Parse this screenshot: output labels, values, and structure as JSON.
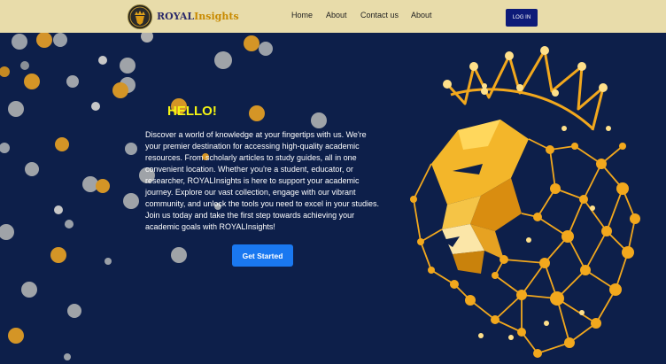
{
  "header": {
    "brand_part1": "ROYAL",
    "brand_part2": "Insights",
    "nav": [
      "Home",
      "About",
      "Contact us",
      "About"
    ],
    "login_label": "LOG IN"
  },
  "hero": {
    "greeting": "HELLO!",
    "description": "Discover a world of knowledge at your fingertips with us. We're your premier destination for accessing high-quality academic resources. From scholarly articles to study guides, all in one convenient location. Whether you're a student, educator, or researcher, ROYALInsights is here to support your academic journey. Explore our vast collection, engage with our vibrant community, and unlock the tools you need to excel in your studies. Join us today and take the first step towards achieving your academic goals with ROYALInsights!",
    "cta_label": "Get Started"
  },
  "colors": {
    "navbar": "#e8dcaa",
    "background": "#0d1f4a",
    "gold": "#f2a81d",
    "yellow": "#f5f513",
    "button_blue": "#1a78f0",
    "login_blue": "#0d1b78"
  },
  "icons": [
    "lion-crown-logo-icon",
    "lion-constellation-illustration"
  ]
}
